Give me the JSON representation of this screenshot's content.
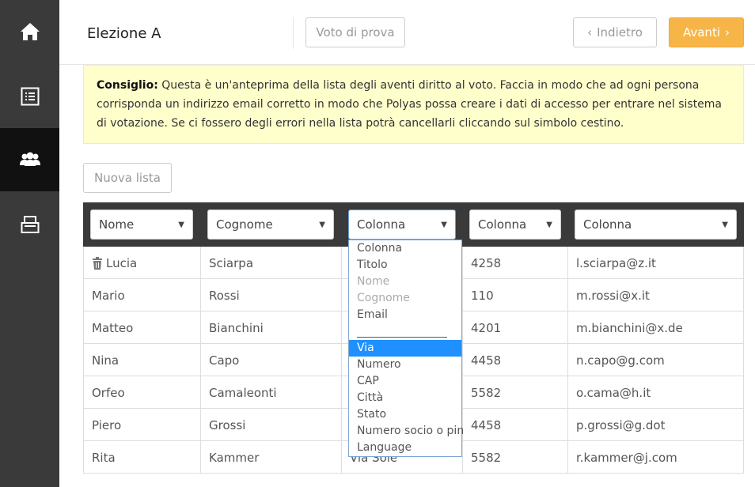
{
  "sidebar": {
    "items": [
      {
        "icon": "home-icon"
      },
      {
        "icon": "list-icon"
      },
      {
        "icon": "users-icon",
        "active": true
      },
      {
        "icon": "ballot-box-icon"
      }
    ]
  },
  "header": {
    "title": "Elezione A",
    "trial_vote_label": "Voto di prova",
    "back_label": "Indietro",
    "next_label": "Avanti"
  },
  "tip": {
    "label": "Consiglio:",
    "text": " Questa è un'anteprima della lista degli aventi diritto al voto. Faccia in modo che ad ogni persona corrisponda un indirizzo email corretto in modo che Polyas possa creare i dati di accesso per entrare nel sistema di votazione. Se ci fossero degli errori nella lista potrà cancellarli cliccando sul simbolo cestino."
  },
  "new_list_label": "Nuova lista",
  "columns": [
    "Nome",
    "Cognome",
    "Colonna",
    "Colonna",
    "Colonna"
  ],
  "rows": [
    [
      "Lucia",
      "Sciarpa",
      "",
      "4258",
      "l.sciarpa@z.it"
    ],
    [
      "Mario",
      "Rossi",
      "",
      "110",
      "m.rossi@x.it"
    ],
    [
      "Matteo",
      "Bianchini",
      "",
      "4201",
      "m.bianchini@x.de"
    ],
    [
      "Nina",
      "Capo",
      "",
      "4458",
      "n.capo@g.com"
    ],
    [
      "Orfeo",
      "Camaleonti",
      "",
      "5582",
      "o.cama@h.it"
    ],
    [
      "Piero",
      "Grossi",
      "",
      "4458",
      "p.grossi@g.dot"
    ],
    [
      "Rita",
      "Kammer",
      "Via Sole",
      "5582",
      "r.kammer@j.com"
    ]
  ],
  "dropdown": {
    "options": [
      "Colonna",
      "Titolo",
      "Nome",
      "Cognome",
      "Email",
      "",
      "Via",
      "Numero",
      "CAP",
      "Città",
      "Stato",
      "Numero socio o pin",
      "Language"
    ],
    "disabled": [
      "Nome",
      "Cognome"
    ],
    "selected": "Via"
  },
  "colors": {
    "sidebar": "#3a3a3a",
    "sidebar_active": "#111111",
    "accent": "#f7b548",
    "tip_bg": "#ffffcc",
    "selected_option": "#1e90ff"
  }
}
